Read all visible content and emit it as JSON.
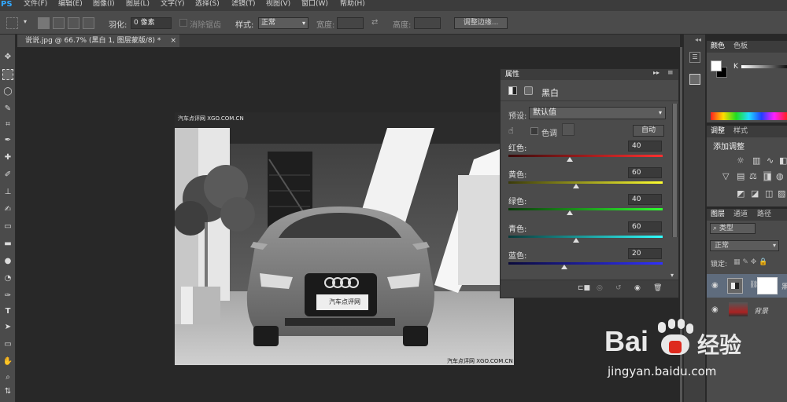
{
  "app_logo": "PS",
  "menu": [
    "文件(F)",
    "编辑(E)",
    "图像(I)",
    "图层(L)",
    "文字(Y)",
    "选择(S)",
    "滤镜(T)",
    "视图(V)",
    "窗口(W)",
    "帮助(H)"
  ],
  "options": {
    "feather_label": "羽化:",
    "feather_value": "0 像素",
    "antialias_label": "消除锯齿",
    "style_label": "样式:",
    "style_value": "正常",
    "width_label": "宽度:",
    "height_label": "高度:",
    "refine_button": "调整边缘..."
  },
  "document_tab": "说说.jpg @ 66.7% (黑白 1, 图层蒙版/8) *",
  "photo_watermarks": {
    "top": "汽车点评网 XGO.COM.CN",
    "bottom": "汽车点评网 XGO.COM.CN",
    "plate": "汽车点评网"
  },
  "properties": {
    "tab": "属性",
    "title": "黑白",
    "preset_label": "预设:",
    "preset_value": "默认值",
    "tint_label": "色调",
    "auto_button": "自动",
    "sliders": [
      {
        "label": "红色:",
        "value": "40",
        "level": 0.4,
        "gradient": [
          "#3a0a0a",
          "#ff3030"
        ]
      },
      {
        "label": "黄色:",
        "value": "60",
        "level": 0.44,
        "gradient": [
          "#3a3a0a",
          "#ffff30"
        ]
      },
      {
        "label": "绿色:",
        "value": "40",
        "level": 0.4,
        "gradient": [
          "#0a3a0a",
          "#30ff30"
        ]
      },
      {
        "label": "青色:",
        "value": "60",
        "level": 0.44,
        "gradient": [
          "#0a3a3a",
          "#30ffff"
        ]
      },
      {
        "label": "蓝色:",
        "value": "20",
        "level": 0.36,
        "gradient": [
          "#0a0a3a",
          "#3030ff"
        ]
      }
    ]
  },
  "color_panel": {
    "tabs": [
      "颜色",
      "色板"
    ],
    "k_label": "K"
  },
  "adjust_panel": {
    "tabs": [
      "调整",
      "样式"
    ],
    "title": "添加调整"
  },
  "layers_panel": {
    "tabs": [
      "图层",
      "通道",
      "路径"
    ],
    "filter_label": "类型",
    "blend_mode": "正常",
    "lock_label": "锁定:",
    "layers": [
      {
        "name": "黑"
      },
      {
        "name": "背景"
      }
    ]
  },
  "watermark": {
    "brand": "Bai",
    "brand2": "经验",
    "url": "jingyan.baidu.com"
  },
  "colors": {
    "accent": "#31a8ff",
    "baidu_red": "#de2a1e"
  }
}
